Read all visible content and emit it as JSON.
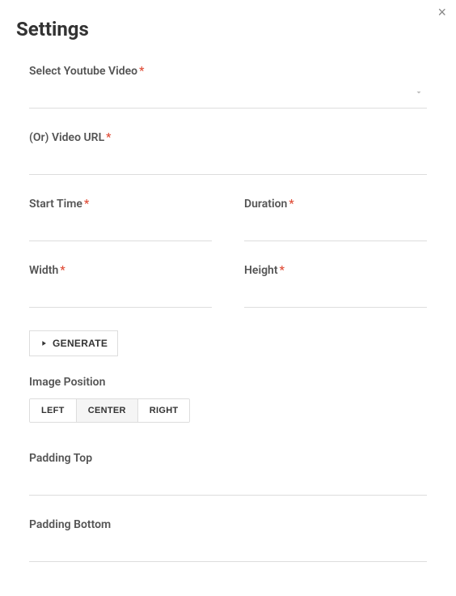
{
  "title": "Settings",
  "close_icon": "×",
  "fields": {
    "select_video": {
      "label": "Select Youtube Video",
      "required": true,
      "value": ""
    },
    "video_url": {
      "label": "(Or) Video URL",
      "required": true,
      "value": ""
    },
    "start_time": {
      "label": "Start Time",
      "required": true,
      "value": ""
    },
    "duration": {
      "label": "Duration",
      "required": true,
      "value": ""
    },
    "width": {
      "label": "Width",
      "required": true,
      "value": ""
    },
    "height": {
      "label": "Height",
      "required": true,
      "value": ""
    },
    "padding_top": {
      "label": "Padding Top",
      "value": ""
    },
    "padding_bottom": {
      "label": "Padding Bottom",
      "value": ""
    }
  },
  "generate_button": "GENERATE",
  "image_position": {
    "label": "Image Position",
    "options": {
      "left": "LEFT",
      "center": "CENTER",
      "right": "RIGHT"
    },
    "active": "center"
  }
}
